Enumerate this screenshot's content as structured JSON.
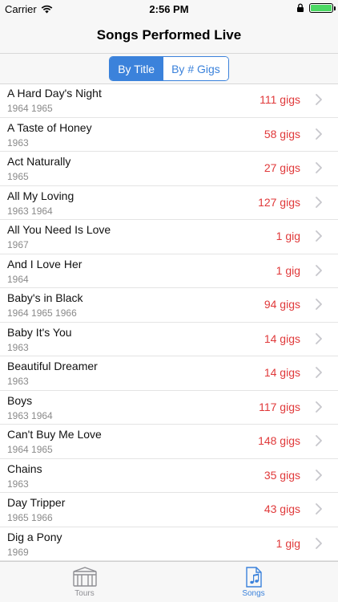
{
  "status": {
    "carrier": "Carrier",
    "time": "2:56 PM",
    "battery_level": 1.0
  },
  "nav": {
    "title": "Songs Performed Live"
  },
  "segment": {
    "options": [
      "By Title",
      "By # Gigs"
    ],
    "selected": 0
  },
  "songs": [
    {
      "title": "A Hard Day's Night",
      "years": "1964 1965",
      "gigs": "111 gigs"
    },
    {
      "title": "A Taste of Honey",
      "years": "1963",
      "gigs": "58 gigs"
    },
    {
      "title": "Act Naturally",
      "years": "1965",
      "gigs": "27 gigs"
    },
    {
      "title": "All My Loving",
      "years": "1963 1964",
      "gigs": "127 gigs"
    },
    {
      "title": "All You Need Is Love",
      "years": "1967",
      "gigs": "1 gig"
    },
    {
      "title": "And I Love Her",
      "years": "1964",
      "gigs": "1 gig"
    },
    {
      "title": "Baby's in Black",
      "years": "1964 1965 1966",
      "gigs": "94 gigs"
    },
    {
      "title": "Baby It's You",
      "years": "1963",
      "gigs": "14 gigs"
    },
    {
      "title": "Beautiful Dreamer",
      "years": "1963",
      "gigs": "14 gigs"
    },
    {
      "title": "Boys",
      "years": "1963 1964",
      "gigs": "117 gigs"
    },
    {
      "title": "Can't Buy Me Love",
      "years": "1964 1965",
      "gigs": "148 gigs"
    },
    {
      "title": "Chains",
      "years": "1963",
      "gigs": "35 gigs"
    },
    {
      "title": "Day Tripper",
      "years": "1965 1966",
      "gigs": "43 gigs"
    },
    {
      "title": "Dig a Pony",
      "years": "1969",
      "gigs": "1 gig"
    }
  ],
  "tabs": [
    {
      "label": "Tours",
      "icon": "tours-icon",
      "active": false
    },
    {
      "label": "Songs",
      "icon": "songs-icon",
      "active": true
    }
  ],
  "colors": {
    "accent": "#3b82db",
    "gigs": "#e0393a",
    "battery": "#4cd964"
  }
}
